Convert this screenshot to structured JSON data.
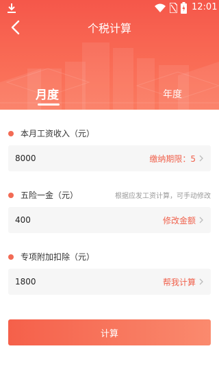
{
  "status": {
    "time": "12:01"
  },
  "header": {
    "title": "个税计算",
    "back_icon": "back-arrow-icon"
  },
  "tabs": [
    {
      "label": "月度",
      "active": true
    },
    {
      "label": "年度",
      "active": false
    }
  ],
  "form": {
    "income": {
      "label": "本月工资收入（元）",
      "value": "8000",
      "action": "缴纳期限：5"
    },
    "insurance": {
      "label": "五险一金（元）",
      "hint": "根据应发工资计算，可手动修改",
      "value": "400",
      "action": "修改金额"
    },
    "deduction": {
      "label": "专项附加扣除（元）",
      "value": "1800",
      "action": "帮我计算"
    }
  },
  "submit": {
    "label": "计算"
  },
  "colors": {
    "accent": "#f0614c",
    "hero_top": "#f5574a",
    "hero_bottom": "#fb7a60",
    "field_bg": "#f6f6f6"
  }
}
